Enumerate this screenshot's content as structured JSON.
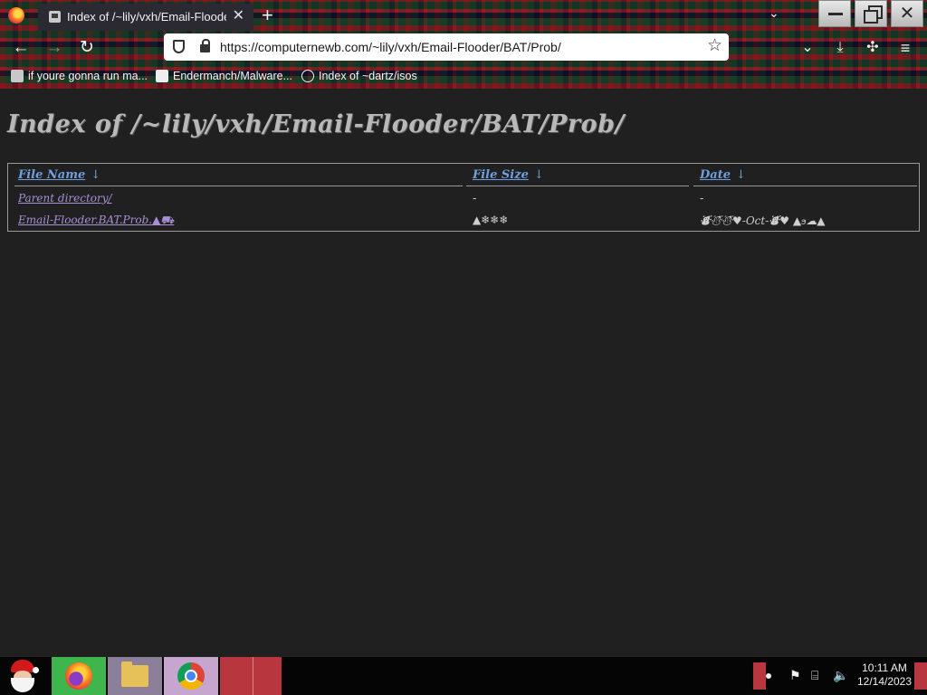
{
  "browser": {
    "tab_title": "Index of /~lily/vxh/Email-Flooder/BAT/Prob/",
    "tab_close": "✕",
    "new_tab": "+",
    "list_tabs": "⌄",
    "url": "https://computernewb.com/~lily/vxh/Email-Flooder/BAT/Prob/",
    "bookmarks": [
      {
        "label": "if youre gonna run ma...",
        "icon": "computer-icon"
      },
      {
        "label": "Endermanch/Malware...",
        "icon": "github-icon"
      },
      {
        "label": "Index of ~dartz/isos",
        "icon": "globe-icon"
      }
    ],
    "glyphs": {
      "back": "←",
      "forward": "→",
      "reload": "↻",
      "star": "☆",
      "pocket": "⌄",
      "download": "⤓",
      "extensions": "✣",
      "menu": "≡",
      "close": "✕"
    }
  },
  "page": {
    "title": "Index of /~lily/vxh/Email-Flooder/BAT/Prob/",
    "columns": [
      {
        "label": "File Name",
        "sort": "↓"
      },
      {
        "label": "File Size",
        "sort": "↓"
      },
      {
        "label": "Date",
        "sort": "↓"
      }
    ],
    "rows": [
      {
        "name": "Parent directory/",
        "size": "-",
        "date": "-"
      },
      {
        "name": "Email-Flooder.BAT.Prob.▲⛟",
        "size": "▲❄❄❄",
        "date": "⛇☃☃♥-Oct-⛇♥ ▲ϧ☁▲"
      }
    ]
  },
  "taskbar": {
    "apps": [
      {
        "name": "Firefox",
        "icon": "firefox-icon"
      },
      {
        "name": "File Explorer",
        "icon": "folder-icon"
      },
      {
        "name": "Google Chrome",
        "icon": "chrome-icon"
      }
    ],
    "tray": {
      "flag": "⚑",
      "network": "⌸",
      "volume": "🔈"
    },
    "time": "10:11 AM",
    "date": "12/14/2023"
  },
  "colors": {
    "page_bg": "#202020",
    "header_link": "#6f9fe0",
    "file_link": "#a78fd6"
  }
}
